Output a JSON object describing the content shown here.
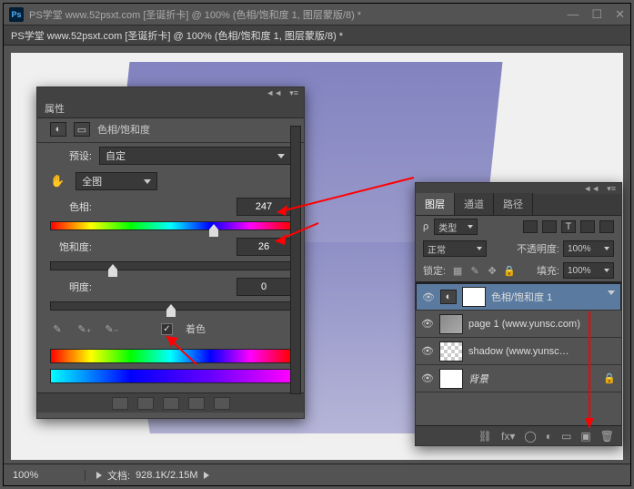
{
  "window": {
    "title": "PS学堂 www.52psxt.com [圣诞折卡] @ 100% (色相/饱和度 1, 图层蒙版/8) *"
  },
  "status": {
    "zoom": "100%",
    "doc_label": "文档:",
    "doc_info": "928.1K/2.15M"
  },
  "properties": {
    "panel_title": "属性",
    "adj_name": "色相/饱和度",
    "preset_label": "预设:",
    "preset_value": "自定",
    "scope_value": "全图",
    "hue_label": "色相:",
    "hue_value": "247",
    "sat_label": "饱和度:",
    "sat_value": "26",
    "light_label": "明度:",
    "light_value": "0",
    "colorize_label": "着色"
  },
  "layers_panel": {
    "tabs": [
      "图层",
      "通道",
      "路径"
    ],
    "kind_label": "类型",
    "blend_value": "正常",
    "opacity_label": "不透明度:",
    "opacity_value": "100%",
    "lock_label": "锁定:",
    "fill_label": "填充:",
    "fill_value": "100%",
    "layers": [
      {
        "name": "色相/饱和度 1"
      },
      {
        "name": "page 1 (www.yunsc.com)"
      },
      {
        "name": "shadow (www.yunsc…"
      },
      {
        "name": "背景"
      }
    ]
  }
}
